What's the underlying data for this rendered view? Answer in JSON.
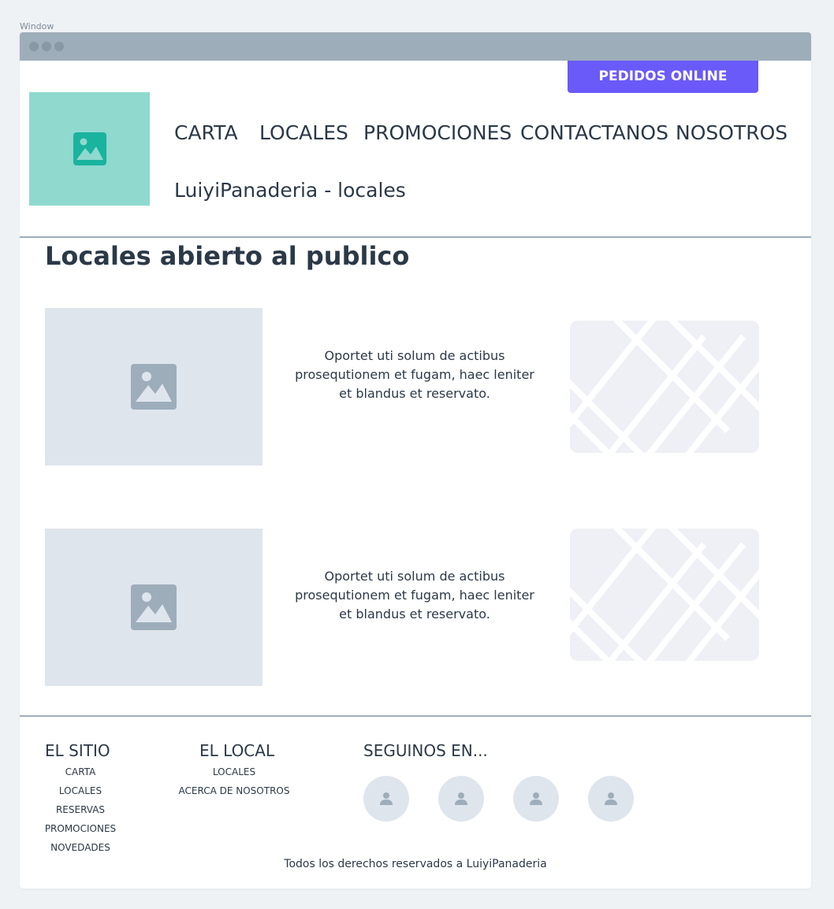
{
  "window": {
    "label": "Window"
  },
  "header": {
    "cta_label": "PEDIDOS ONLINE",
    "logo_icon": "image-icon",
    "nav": [
      {
        "label": "CARTA"
      },
      {
        "label": "LOCALES"
      },
      {
        "label": "PROMOCIONES"
      },
      {
        "label": "CONTACTANOS"
      },
      {
        "label": "NOSOTROS"
      }
    ],
    "subtitle": "LuiyiPanaderia - locales"
  },
  "main": {
    "title": "Locales abierto al publico",
    "locales": [
      {
        "text": "Oportet uti solum de actibus prosequtionem et fugam, haec leniter et blandus et reservato.",
        "image_icon": "image-icon",
        "map_icon": "map-icon"
      },
      {
        "text": "Oportet uti solum de actibus prosequtionem et fugam, haec leniter et blandus et reservato.",
        "image_icon": "image-icon",
        "map_icon": "map-icon"
      }
    ]
  },
  "footer": {
    "sitio": {
      "title": "EL SITIO",
      "links": [
        "CARTA",
        "LOCALES",
        "RESERVAS",
        "PROMOCIONES",
        "NOVEDADES"
      ]
    },
    "local": {
      "title": "EL LOCAL",
      "links": [
        "LOCALES",
        "ACERCA DE NOSOTROS"
      ]
    },
    "social": {
      "title": "SEGUINOS EN...",
      "icons": [
        "user-icon",
        "user-icon",
        "user-icon",
        "user-icon"
      ]
    },
    "copyright": "Todos los derechos reservados a LuiyiPanaderia"
  },
  "colors": {
    "accent": "#6a5af9",
    "logo_bg": "#8fd9cf",
    "logo_icon": "#1ab39e",
    "titlebar": "#9eadba",
    "placeholder": "#dfe5ed",
    "text": "#2b3947"
  }
}
